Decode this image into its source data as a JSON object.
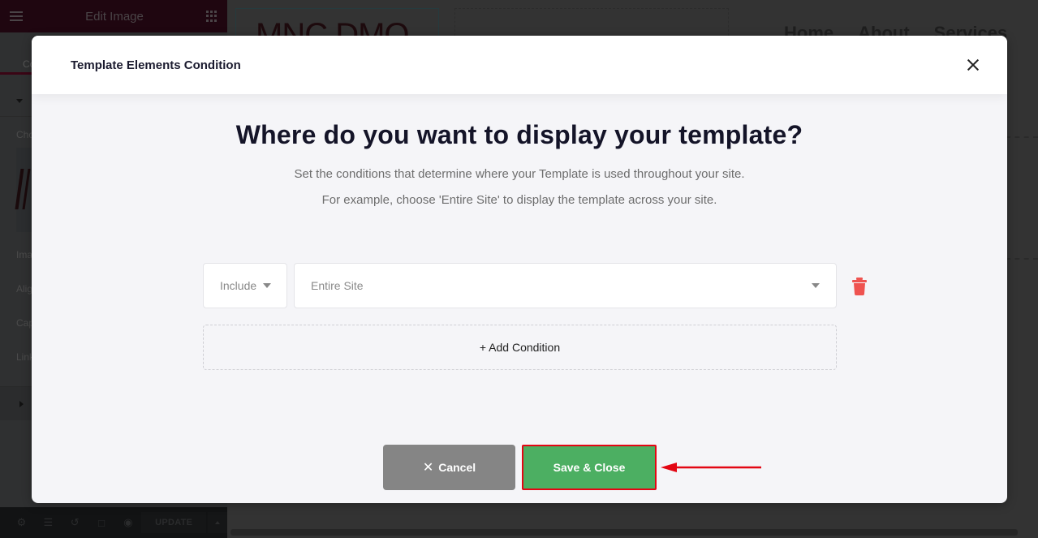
{
  "sidebar": {
    "title": "Edit Image",
    "tab_partial": "Co",
    "labels": [
      "Cho",
      "Ima",
      "Alig",
      "Cap",
      "Link"
    ],
    "footer": {
      "icons": [
        "settings-icon",
        "layers-icon",
        "history-icon",
        "responsive-icon",
        "preview-eye-icon"
      ],
      "update_label": "UPDATE"
    }
  },
  "preview": {
    "logo_text": "MNC DMO",
    "nav": [
      "Home",
      "About",
      "Services"
    ]
  },
  "modal": {
    "title": "Template Elements Condition",
    "heading": "Where do you want to display your template?",
    "description_1": "Set the conditions that determine where your Template is used throughout your site.",
    "description_2": "For example, choose 'Entire Site' to display the template across your site.",
    "condition": {
      "type_value": "Include",
      "target_value": "Entire Site"
    },
    "add_condition_label": "+ Add Condition",
    "cancel_label": "Cancel",
    "save_label": "Save & Close"
  },
  "colors": {
    "save_green": "#4caf62",
    "highlight_red": "#e30613",
    "trash_red": "#ef5350",
    "cancel_gray": "#858585"
  }
}
